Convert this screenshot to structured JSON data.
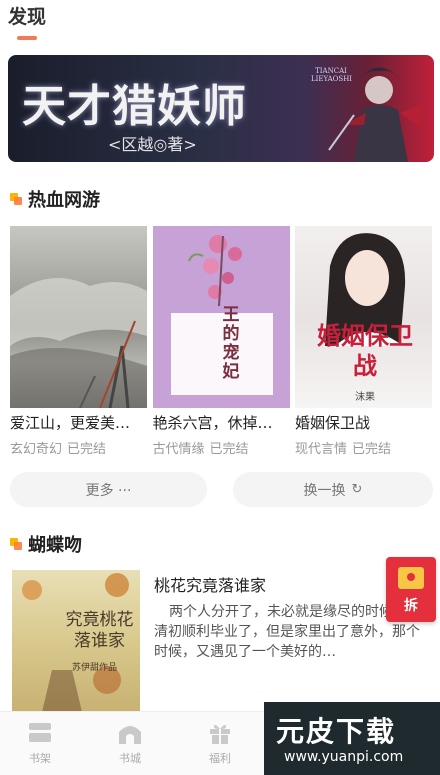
{
  "header": {
    "title": "发现"
  },
  "banner": {
    "title": "天才猎妖师",
    "author": "<区越◎著>",
    "tag": "TIANCAI LIEYAOSHI"
  },
  "section_hot": {
    "title": "热血网游",
    "books": [
      {
        "title": "爱江山，更爱美…",
        "genre": "玄幻奇幻",
        "status": "已完结"
      },
      {
        "title": "艳杀六宫，休掉…",
        "genre": "古代情缘",
        "status": "已完结",
        "cover_text": "王的宠妃"
      },
      {
        "title": "婚姻保卫战",
        "genre": "现代言情",
        "status": "已完结",
        "cover_text": "婚姻保卫战",
        "cover_author": "沫果"
      }
    ],
    "more_label": "更多 ···",
    "swap_label": "换一换"
  },
  "section_butterfly": {
    "title": "蝴蝶吻",
    "book": {
      "title": "桃花究竟落谁家",
      "description": "两个人分开了，未必就是缘尽的时候。刘清初顺利毕业了，但是家里出了意外，那个时候，又遇见了一个美好的…",
      "cover_text": "究竟桃花落谁家",
      "cover_author": "苏伊甜作品"
    }
  },
  "fab": {
    "label": "拆"
  },
  "tabbar": {
    "tabs": [
      {
        "label": "书架"
      },
      {
        "label": "书城"
      },
      {
        "label": "福利"
      }
    ]
  },
  "watermark": {
    "brand": "元皮下载",
    "url": "www.yuanpi.com"
  },
  "colors": {
    "accent": "#f47a55",
    "fab": "#e3303c",
    "section_icon": "#ffb400"
  }
}
